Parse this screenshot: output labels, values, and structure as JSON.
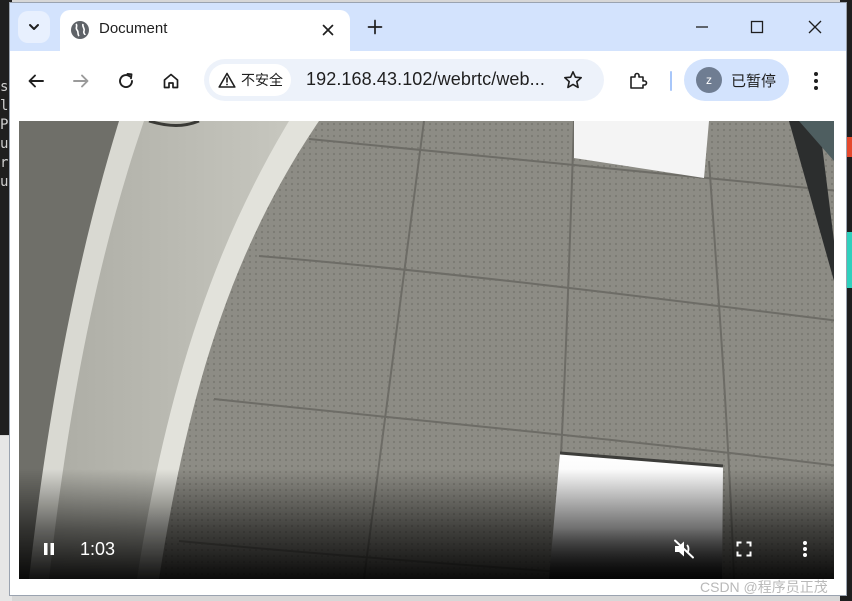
{
  "background": {
    "terminal_chars": [
      "s",
      "l",
      "P",
      "u",
      "r",
      "u"
    ]
  },
  "browser": {
    "tab": {
      "title": "Document"
    },
    "omnibox": {
      "security_label": "不安全",
      "url": "192.168.43.102/webrtc/web..."
    },
    "profile": {
      "initial": "z",
      "label": "已暂停"
    }
  },
  "video": {
    "current_time": "1:03",
    "state": "playing",
    "muted": true
  },
  "watermark": "CSDN @程序员正茂",
  "colors": {
    "tabstrip": "#d3e3fd",
    "omnibox": "#edf2fa",
    "profile_chip": "#d3e3fd",
    "avatar": "#6f7d92"
  }
}
